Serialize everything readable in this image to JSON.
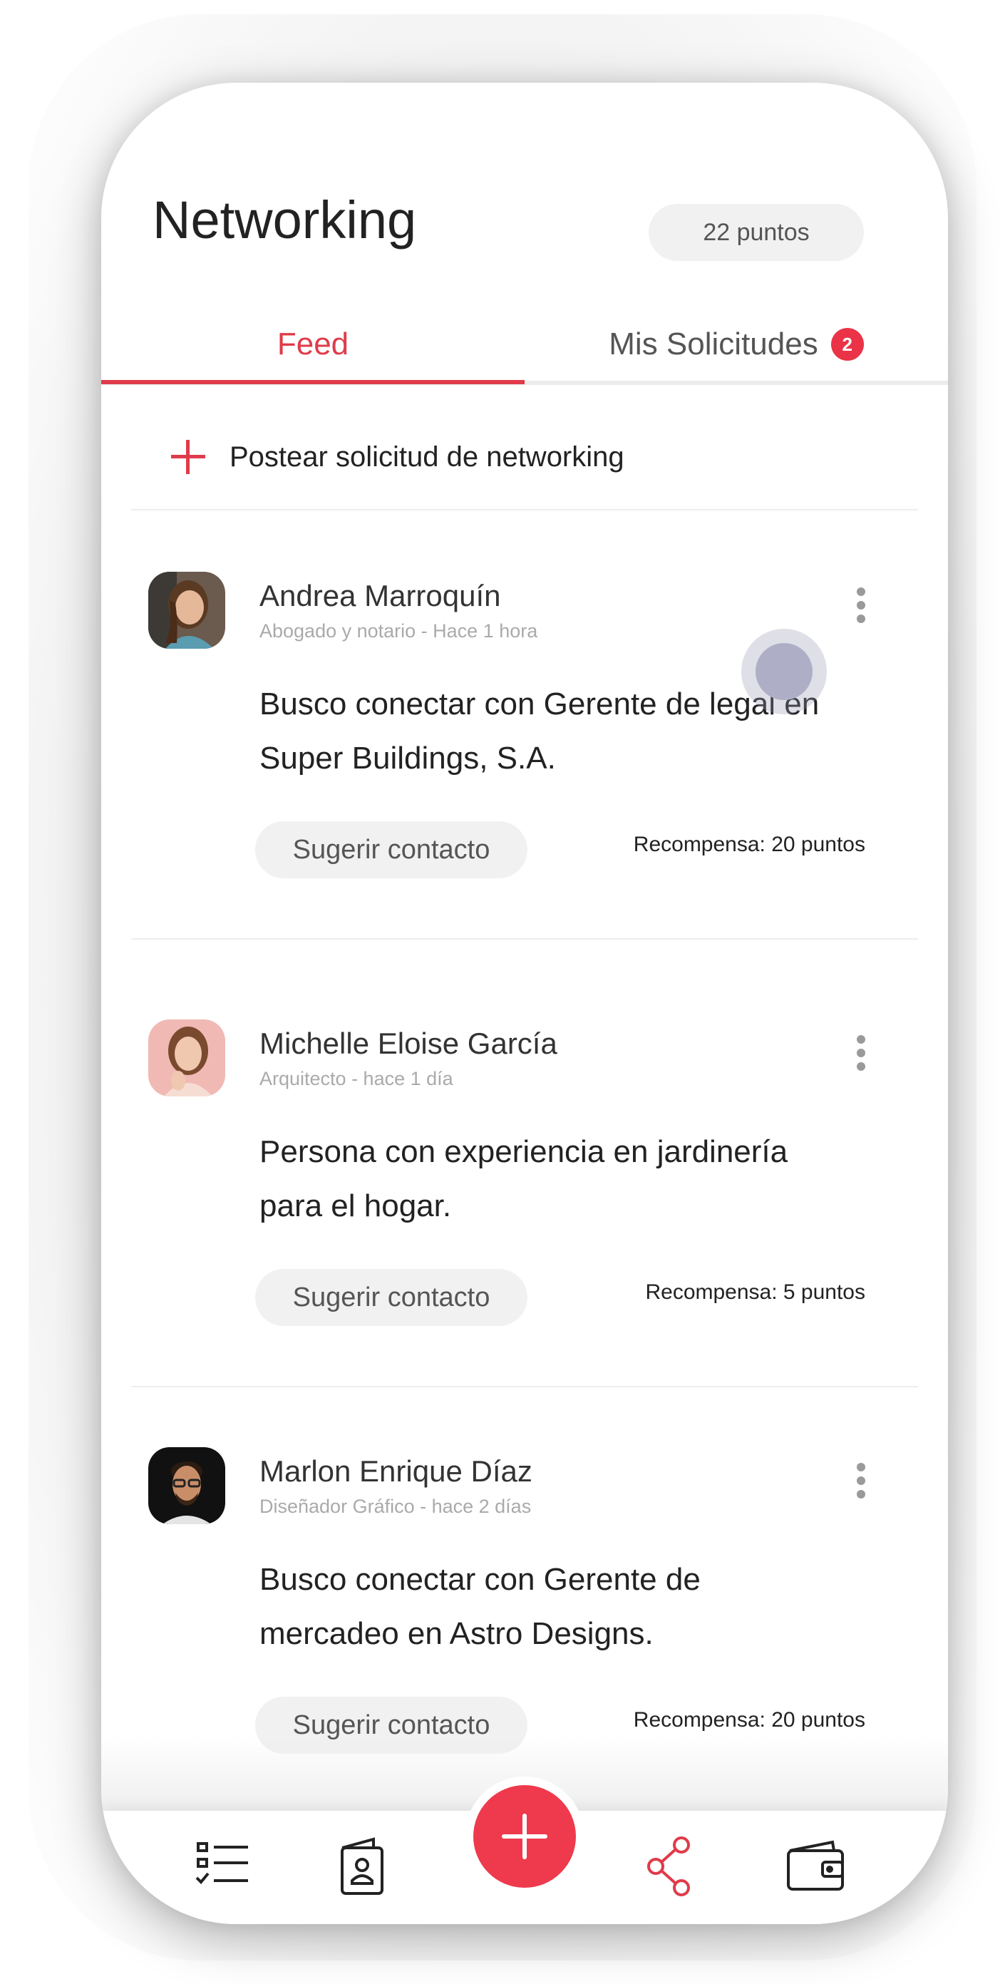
{
  "header": {
    "title": "Networking",
    "points": "22 puntos"
  },
  "tabs": {
    "feed": "Feed",
    "requests": "Mis Solicitudes",
    "requests_badge": "2"
  },
  "post_action": {
    "label": "Postear solicitud de networking"
  },
  "feed": [
    {
      "name": "Andrea Marroquín",
      "meta": "Abogado y notario - Hace 1 hora",
      "body": "Busco conectar con Gerente de legal en Super Buildings, S.A.",
      "button": "Sugerir contacto",
      "reward": "Recompensa: 20 puntos"
    },
    {
      "name": "Michelle Eloise García",
      "meta": "Arquitecto - hace 1 día",
      "body": "Persona con experiencia en jardinería para el hogar.",
      "button": "Sugerir contacto",
      "reward": "Recompensa: 5 puntos"
    },
    {
      "name": "Marlon Enrique Díaz",
      "meta": "Diseñador Gráfico - hace 2 días",
      "body": "Busco conectar con Gerente de mercadeo en Astro Designs.",
      "button": "Sugerir contacto",
      "reward": "Recompensa: 20 puntos"
    }
  ],
  "bottom_nav": {
    "icons": [
      "checklist-icon",
      "id-badge-icon",
      "add-icon",
      "share-icon",
      "wallet-icon"
    ]
  },
  "colors": {
    "accent": "#e03b4a",
    "badge": "#ea3347",
    "fab": "#ee3a4c"
  }
}
